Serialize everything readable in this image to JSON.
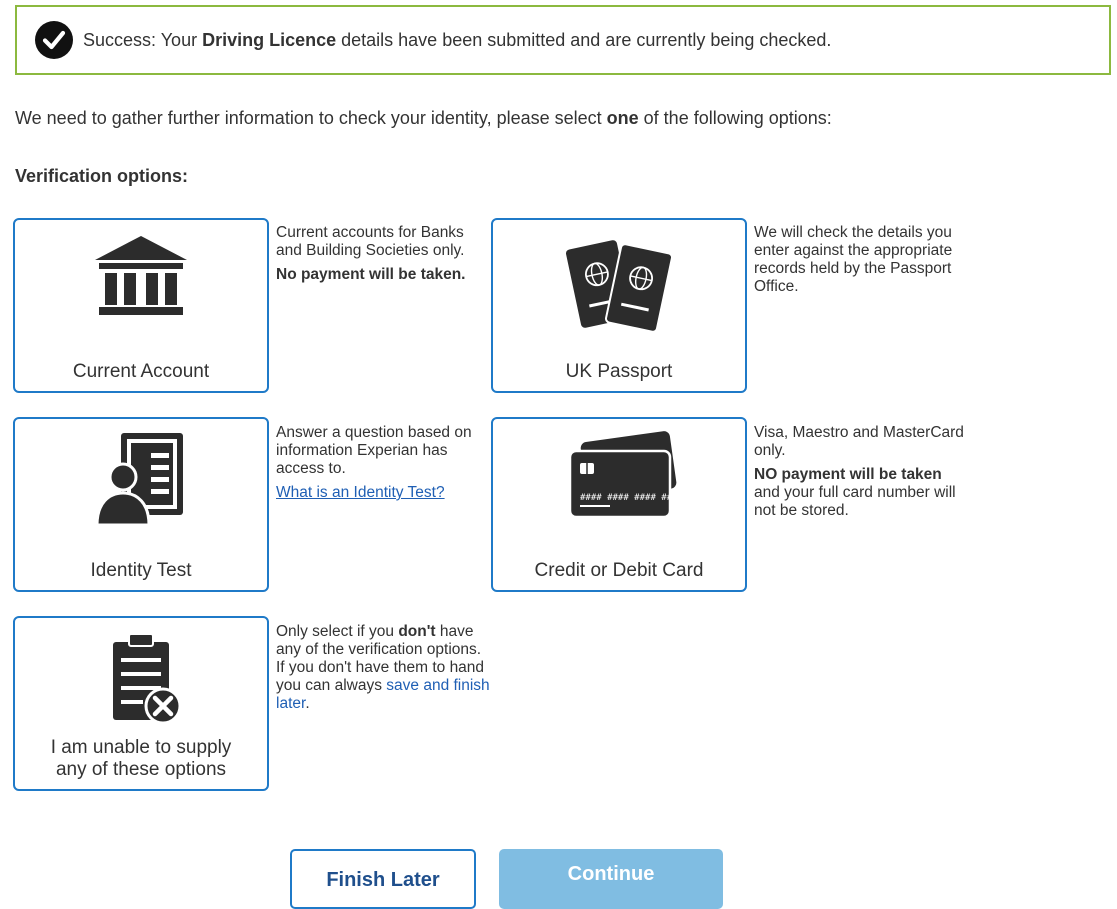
{
  "success": {
    "prefix": "Success: Your ",
    "bold": "Driving Licence",
    "suffix": " details have been submitted and are currently being checked."
  },
  "intro": {
    "before": "We need to gather further information to check your identity, please select ",
    "bold": "one",
    "after": " of the following options:"
  },
  "heading": "Verification options:",
  "options": {
    "current_account": {
      "label": "Current Account",
      "icon": "bank-icon",
      "desc1": "Current accounts for Banks and Building Societies only.",
      "desc2_bold": "No payment will be taken."
    },
    "uk_passport": {
      "label": "UK Passport",
      "icon": "passport-icon",
      "desc1": "We will check the details you enter against the appropriate records held by the Passport Office."
    },
    "identity_test": {
      "label": "Identity Test",
      "icon": "document-person-icon",
      "desc1": "Answer a question based on information Experian has access to.",
      "link": "What is an Identity Test?"
    },
    "card": {
      "label": "Credit or Debit Card",
      "icon": "credit-card-icon",
      "desc1": "Visa, Maestro and MasterCard only.",
      "desc2_bold": "NO payment will be taken",
      "desc2_rest": " and your full card number will not be stored."
    },
    "unable": {
      "label_line1": "I am unable to supply",
      "label_line2": "any of these options",
      "icon": "clipboard-x-icon",
      "desc_before": "Only select if you ",
      "desc_bold": "don't",
      "desc_after": " have any of the verification options.",
      "desc2": "If you don't have them to hand you can always ",
      "link": "save and finish later",
      "desc2_end": "."
    }
  },
  "buttons": {
    "finish_later": "Finish Later",
    "continue": "Continue"
  },
  "colors": {
    "success_border": "#8cb93f",
    "option_border": "#1f7ac8",
    "continue_bg": "#80bde2",
    "link": "#1f5fb4"
  }
}
